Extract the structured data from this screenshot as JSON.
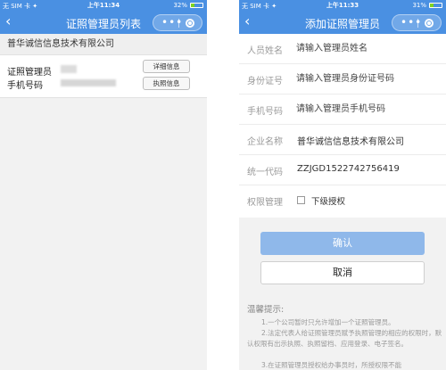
{
  "left": {
    "status": {
      "carrier": "无 SIM 卡 ✦",
      "time": "上午11:34",
      "battery": "32%",
      "battery_level": 0.32
    },
    "nav": {
      "title": "证照管理员列表",
      "back": "‹",
      "menu": "•••"
    },
    "company": "普华诚信信息技术有限公司",
    "admin": {
      "label_name": "证照管理员",
      "label_phone": "手机号码",
      "detail_button": "详细信息",
      "license_button": "执照信息"
    }
  },
  "right": {
    "status": {
      "carrier": "无 SIM 卡 ✦",
      "time": "上午11:33",
      "battery": "31%",
      "battery_level": 0.31
    },
    "nav": {
      "title": "添加证照管理员",
      "back": "‹",
      "menu": "•••"
    },
    "fields": {
      "name_label": "人员姓名",
      "name_placeholder": "请输入管理员姓名",
      "id_label": "身份证号",
      "id_placeholder": "请输入管理员身份证号码",
      "phone_label": "手机号码",
      "phone_placeholder": "请输入管理员手机号码",
      "company_label": "企业名称",
      "company_value": "普华诚信信息技术有限公司",
      "code_label": "统一代码",
      "code_value": "ZZJGD1522742756419",
      "perm_label": "权限管理",
      "perm_option": "下级授权"
    },
    "buttons": {
      "confirm": "确认",
      "cancel": "取消"
    },
    "tips": {
      "title": "温馨提示:",
      "items": [
        "1.一个公司暂时只允许增加一个证照管理员。",
        "2.法定代表人给证照管理员赋予执照管理的相应的权限时，默认权限有出示执照、执照留档、应用登录、电子签名。",
        "3.在证照管理员授权给办事员时，所授权限不能"
      ]
    },
    "colors": {
      "accent": "#4a90e2",
      "confirm_bg": "#8fb8ea"
    }
  }
}
